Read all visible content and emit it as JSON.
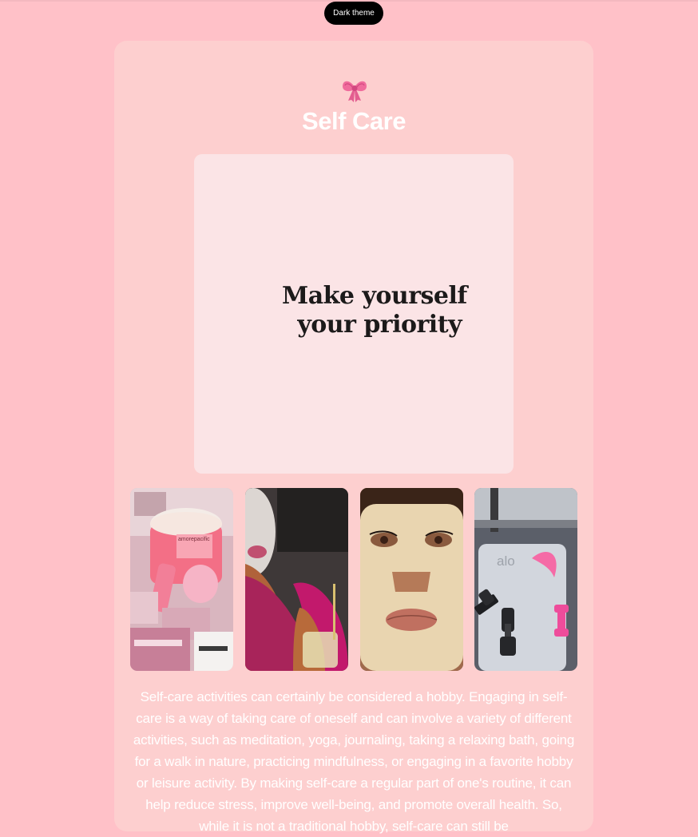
{
  "theme_toggle": {
    "label": "Dark theme"
  },
  "page": {
    "icon": "ribbon-bow-icon",
    "title": "Self Care",
    "hero": {
      "lines": [
        "Make yourself",
        "your priority"
      ]
    },
    "gallery": [
      {
        "name": "skincare-products-photo",
        "logo_text": "amorepacific"
      },
      {
        "name": "face-mask-selfie-photo"
      },
      {
        "name": "hydrogel-mask-photo"
      },
      {
        "name": "alo-yoga-mat-dumbbells-photo",
        "logo_text": "alo"
      }
    ],
    "description": "Self-care activities can certainly be considered a hobby. Engaging in self-care is a way of taking care of oneself and can involve a variety of different activities, such as meditation, yoga, journaling, taking a relaxing bath, going for a walk in nature, practicing mindfulness, or engaging in a favorite hobby or leisure activity. By making self-care a regular part of one's routine, it can help reduce stress, improve well-being, and promote overall health. So, while it is not a traditional hobby, self-care can still be"
  },
  "colors": {
    "background": "#ffc1c8",
    "card": "#fdcfcf",
    "hero": "#fbe4e6",
    "button": "#000000"
  }
}
